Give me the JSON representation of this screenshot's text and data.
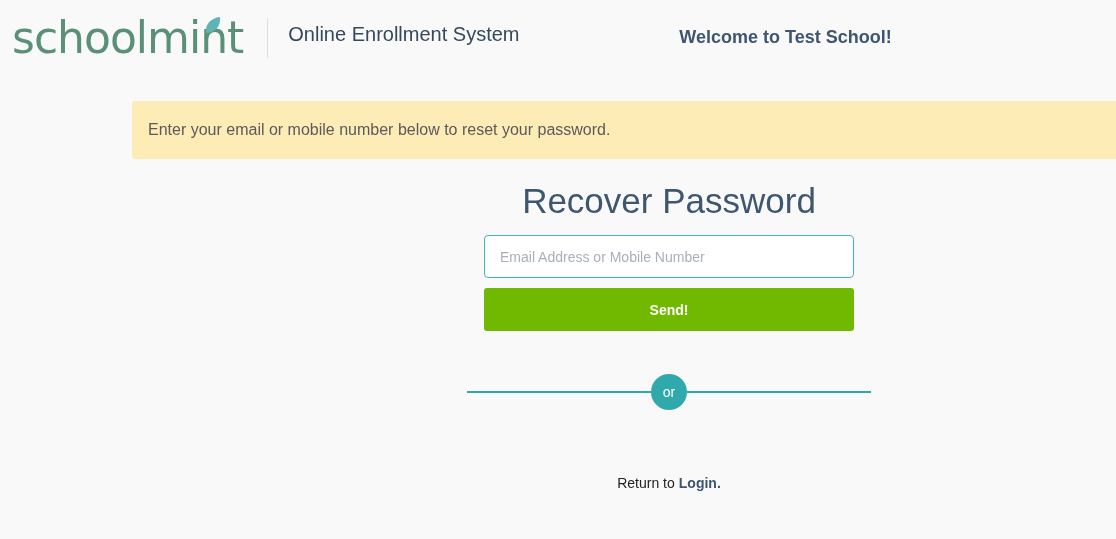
{
  "header": {
    "logo": "schoolmint",
    "title": "Online Enrollment System",
    "welcome": "Welcome to Test School!"
  },
  "alert": "Enter your email or mobile number below to reset your password.",
  "form": {
    "heading": "Recover Password",
    "field": {
      "placeholder": "Email Address or Mobile Number"
    },
    "button": "Send!",
    "separator": "or",
    "footer": {
      "text": "Return to",
      "link": "Login."
    }
  }
}
